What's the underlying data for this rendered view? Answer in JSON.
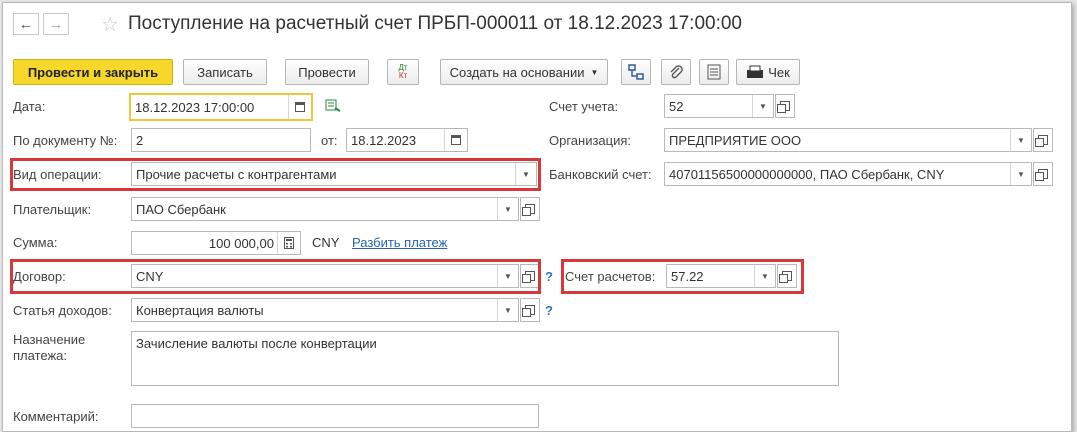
{
  "window": {
    "title": "Поступление на расчетный счет ПРБП-000011 от 18.12.2023 17:00:00"
  },
  "nav": {
    "back_icon": "arrow-left-icon",
    "forward_icon": "arrow-right-icon",
    "favorite_icon": "star-icon"
  },
  "toolbar": {
    "post_close": "Провести и закрыть",
    "save": "Записать",
    "post": "Провести",
    "dt": "Дт",
    "kt": "Кт",
    "create_based": "Создать на основании",
    "check": "Чек"
  },
  "form": {
    "date_label": "Дата:",
    "date_value": "18.12.2023 17:00:00",
    "doc_label": "По документу №:",
    "doc_value": "2",
    "from_label": "от:",
    "from_value": "18.12.2023",
    "op_label": "Вид операции:",
    "op_value": "Прочие расчеты с контрагентами",
    "payer_label": "Плательщик:",
    "payer_value": "ПАО Сбербанк",
    "sum_label": "Сумма:",
    "sum_value": "100 000,00",
    "currency": "CNY",
    "split_link": "Разбить платеж",
    "contract_label": "Договор:",
    "contract_value": "CNY",
    "income_label": "Статья доходов:",
    "income_value": "Конвертация валюты",
    "purpose_label_1": "Назначение",
    "purpose_label_2": "платежа:",
    "purpose_value": "Зачисление валюты после конвертации",
    "comment_label": "Комментарий:",
    "comment_value": "",
    "account_label": "Счет учета:",
    "account_value": "52",
    "org_label": "Организация:",
    "org_value": "ПРЕДПРИЯТИЕ ООО",
    "bank_label": "Банковский счет:",
    "bank_value": "40701156500000000000, ПАО Сбербанк, CNY",
    "settle_label": "Счет расчетов:",
    "settle_value": "57.22",
    "help": "?"
  },
  "colors": {
    "highlight": "#d9383a",
    "primary": "#f8d72d",
    "focus": "#f0c63a",
    "link": "#2464b4"
  }
}
